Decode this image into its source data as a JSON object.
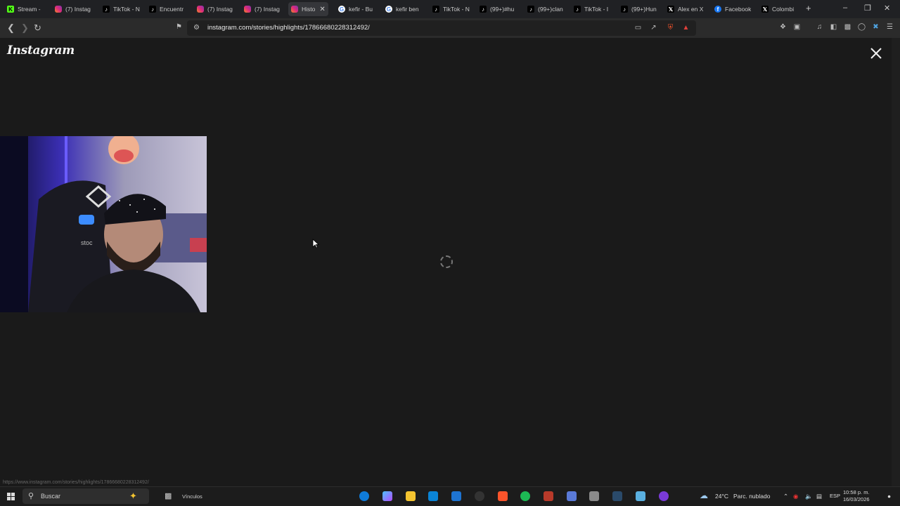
{
  "tabs": [
    {
      "label": "Stream -",
      "icon": "kick-icon",
      "color": "#53fc18"
    },
    {
      "label": "(7) Instag",
      "icon": "instagram-icon",
      "color": "#e1306c"
    },
    {
      "label": "TikTok - N",
      "icon": "tiktok-icon",
      "color": "#000000"
    },
    {
      "label": "Encuentr",
      "icon": "tiktok-icon",
      "color": "#000000"
    },
    {
      "label": "(7) Instag",
      "icon": "instagram-icon",
      "color": "#e1306c"
    },
    {
      "label": "(7) Instag",
      "icon": "instagram-icon",
      "color": "#e1306c"
    },
    {
      "label": "Histo",
      "icon": "instagram-icon",
      "color": "#e1306c",
      "active": true
    },
    {
      "label": "kefir - Bu",
      "icon": "google-icon",
      "color": "#4285f4"
    },
    {
      "label": "kefir ben",
      "icon": "google-icon",
      "color": "#4285f4"
    },
    {
      "label": "TikTok - N",
      "icon": "tiktok-icon",
      "color": "#000000"
    },
    {
      "label": "(99+)#hu",
      "icon": "tiktok-icon",
      "color": "#000000"
    },
    {
      "label": "(99+)clan",
      "icon": "tiktok-icon",
      "color": "#000000"
    },
    {
      "label": "TikTok - I",
      "icon": "tiktok-icon",
      "color": "#000000"
    },
    {
      "label": "(99+)Hun",
      "icon": "tiktok-icon",
      "color": "#000000"
    },
    {
      "label": "Alex en X",
      "icon": "x-icon",
      "color": "#000000"
    },
    {
      "label": "Facebook",
      "icon": "facebook-icon",
      "color": "#1877f2"
    },
    {
      "label": "Colombi",
      "icon": "x-icon",
      "color": "#000000"
    }
  ],
  "address": {
    "url": "instagram.com/stories/highlights/17866680228312492/"
  },
  "page": {
    "logo": "Instagram",
    "status_url": "https://www.instagram.com/stories/highlights/17866680228312492/"
  },
  "taskbar": {
    "search_label": "Buscar",
    "links_label": "Vínculos",
    "weather": "24°C",
    "weather_desc": "Parc. nublado",
    "language": "ESP",
    "time": "10:58 p. m.",
    "date": "16/03/2026"
  },
  "colors": {
    "accent_red": "#e0403a",
    "brave_orange": "#fb542b",
    "background": "#1a1a1a"
  }
}
